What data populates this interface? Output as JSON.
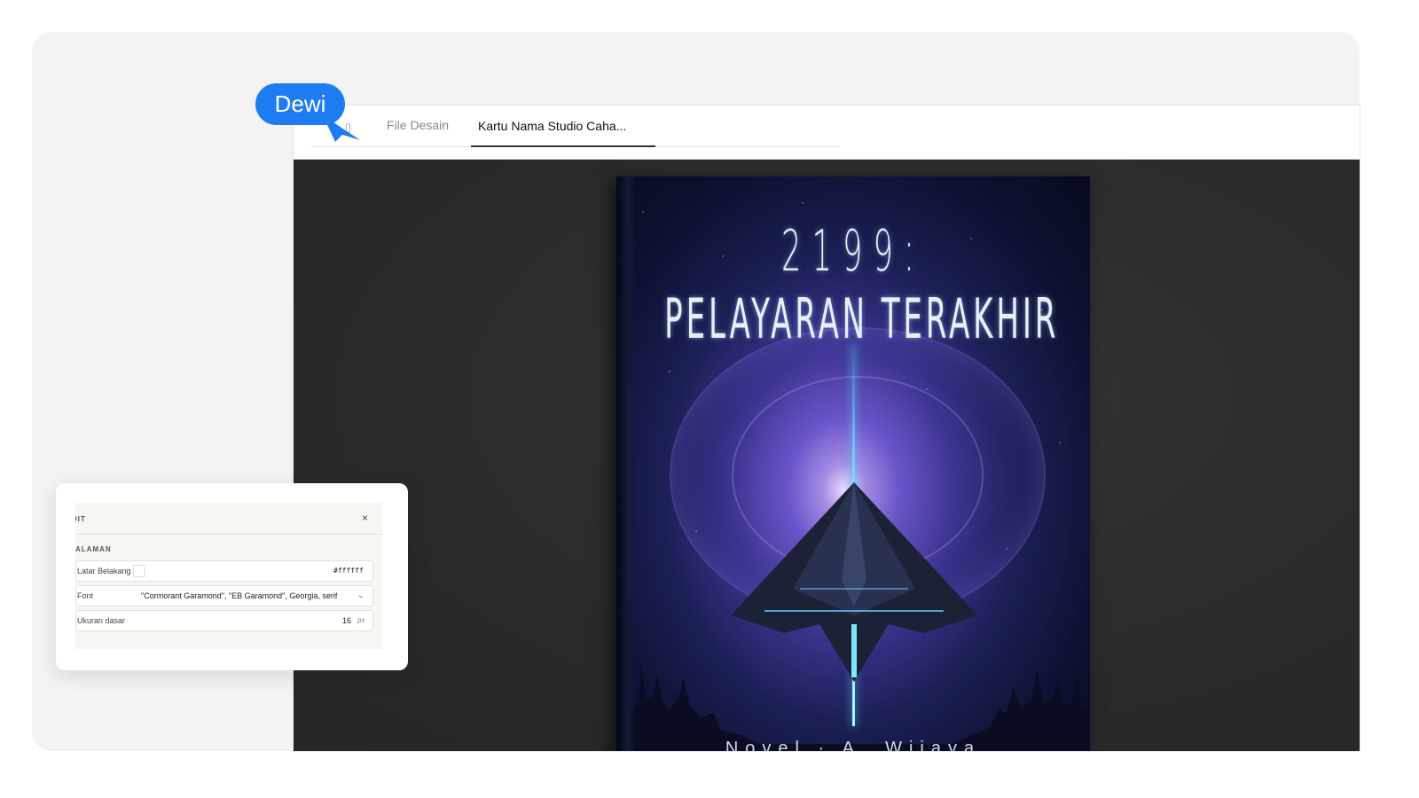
{
  "cursor": {
    "user_name": "Dewi",
    "color": "#1e7cf2"
  },
  "tabs": {
    "file_label": "File Desain",
    "active_label": "Kartu Nama Studio Caha..."
  },
  "book": {
    "title_line1": "2199:",
    "title_line2": "PELAYARAN TERAKHIR",
    "author": "Novel · A. Wijaya"
  },
  "edit_panel": {
    "title": "DIT",
    "section": "ALAMAN",
    "close_icon": "×",
    "fields": {
      "background": {
        "label": "Latar Belakang",
        "value": "#ffffff"
      },
      "font": {
        "label": "Font",
        "value": "\"Cormorant Garamond\", \"EB Garamond\", Georgia, serif"
      },
      "base_size": {
        "label": "Ukuran dasar",
        "value": "16",
        "unit": "px"
      }
    }
  },
  "icons": {
    "tab_icon": "file-icon",
    "close": "close-icon",
    "chevron": "chevron-down-icon",
    "cursor": "cursor-arrow-icon"
  }
}
